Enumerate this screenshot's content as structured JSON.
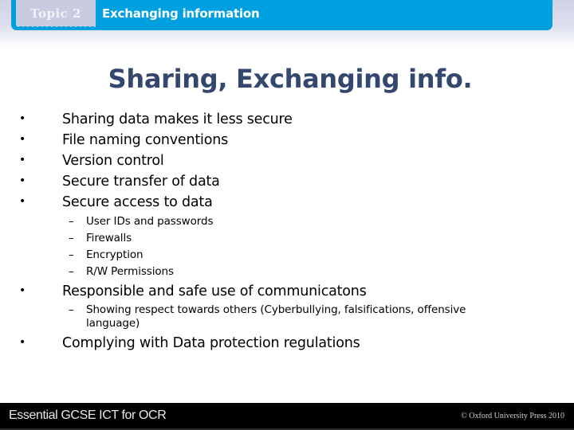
{
  "header": {
    "topic_label": "Topic 2",
    "section_title": "Exchanging information",
    "accent_color": "#009fdf",
    "tab_color": "#c9cce0"
  },
  "slide": {
    "title": "Sharing, Exchanging info.",
    "title_color": "#34476f",
    "bullets": [
      {
        "text": "Sharing data makes it less secure"
      },
      {
        "text": "File naming conventions"
      },
      {
        "text": "Version control"
      },
      {
        "text": "Secure transfer of data"
      },
      {
        "text": "Secure access to data",
        "sub": [
          "User IDs and passwords",
          "Firewalls",
          "Encryption",
          "R/W Permissions"
        ]
      },
      {
        "text": "Responsible and safe use of communicatons",
        "sub": [
          "Showing respect towards others (Cyberbullying, falsifications, offensive language)"
        ]
      },
      {
        "text": "Complying with Data protection regulations"
      }
    ],
    "bullet_glyph": "•",
    "sub_bullet_glyph": "–"
  },
  "footer": {
    "title": "Essential GCSE ICT for OCR",
    "copyright": "© Oxford University Press 2010"
  }
}
